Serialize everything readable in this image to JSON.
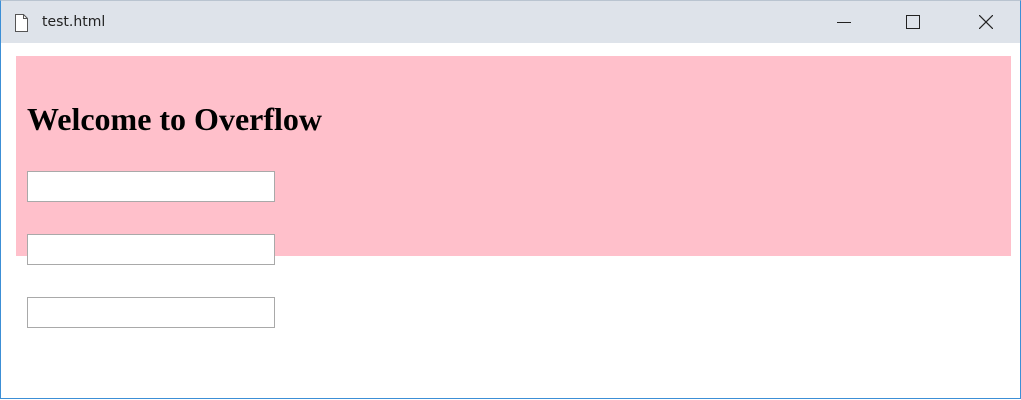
{
  "window": {
    "title": "test.html",
    "file_icon": "document-icon",
    "controls": {
      "minimize_icon": "minimize-icon",
      "maximize_icon": "maximize-icon",
      "close_icon": "close-icon"
    }
  },
  "page": {
    "heading": "Welcome to Overflow",
    "banner_color": "#ffc0cb",
    "inputs": [
      {
        "value": "",
        "placeholder": ""
      },
      {
        "value": "",
        "placeholder": ""
      },
      {
        "value": "",
        "placeholder": ""
      }
    ]
  }
}
